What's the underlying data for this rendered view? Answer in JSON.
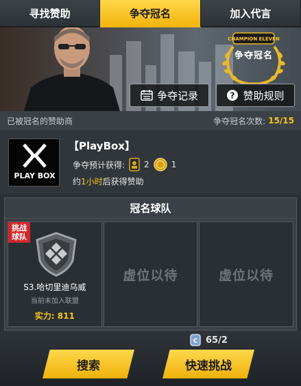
{
  "tabs": [
    {
      "label": "寻找赞助",
      "active": false
    },
    {
      "label": "争夺冠名",
      "active": true
    },
    {
      "label": "加入代言",
      "active": false
    }
  ],
  "banner": {
    "emblem_brand": "CHAMPION ELEVEN",
    "emblem_title": "争夺冠名",
    "record_button": "争夺记录",
    "rules_button": "赞助规则"
  },
  "subbar": {
    "left_text": "已被冠名的赞助商",
    "count_label": "争夺冠名次数:",
    "count_value": "15/15"
  },
  "sponsor": {
    "logo_text": "PLAY BOX",
    "name": "【PlayBox】",
    "reward_label": "争夺预计获得:",
    "reward_card_count": "2",
    "reward_coin_count": "1",
    "time_prefix": "约",
    "time_highlight": "1小时",
    "time_suffix": "后获得赞助"
  },
  "team_panel": {
    "title": "冠名球队",
    "slots": [
      {
        "badge": "挑战球队",
        "team_name": "S3.哈切里迪乌威",
        "league": "当前未加入联盟",
        "power_label": "实力:",
        "power_value": "811"
      },
      {
        "empty_text": "虚位以待"
      },
      {
        "empty_text": "虚位以待"
      }
    ]
  },
  "bottom": {
    "ticket_value": "65/2",
    "search_button": "搜索",
    "quick_button": "快速挑战"
  },
  "colors": {
    "accent_yellow": "#f5c320",
    "badge_red": "#d3262b",
    "panel_dark": "#2a2f33"
  }
}
